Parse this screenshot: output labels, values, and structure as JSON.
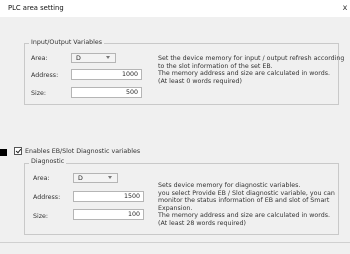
{
  "window": {
    "title": "PLC area setting",
    "close_glyph": "x"
  },
  "io_group": {
    "title": "Input/Output Variables",
    "area_label": "Area:",
    "area_value": "D",
    "address_label": "Address:",
    "address_value": "1000",
    "size_label": "Size:",
    "size_value": "500",
    "description": "Set the device memory for input / output refresh according\nto the slot information of the set EB.\nThe memory address and size are calculated in words.\n(At least 0 words required)"
  },
  "enable_diag": {
    "label": "Enables EB/Slot Diagnostic variables",
    "checked": true
  },
  "diag_group": {
    "title": "Diagnostic",
    "area_label": "Area:",
    "area_value": "D",
    "address_label": "Address:",
    "address_value": "1500",
    "size_label": "Size:",
    "size_value": "100",
    "description": "Sets device memory for diagnostic variables.\n you select Provide EB / Slot diagnostic variable, you can\nmonitor the status information of EB and slot of Smart\nExpansion.\n The memory address and size are calculated in words.\n(At least 28 words required)"
  }
}
